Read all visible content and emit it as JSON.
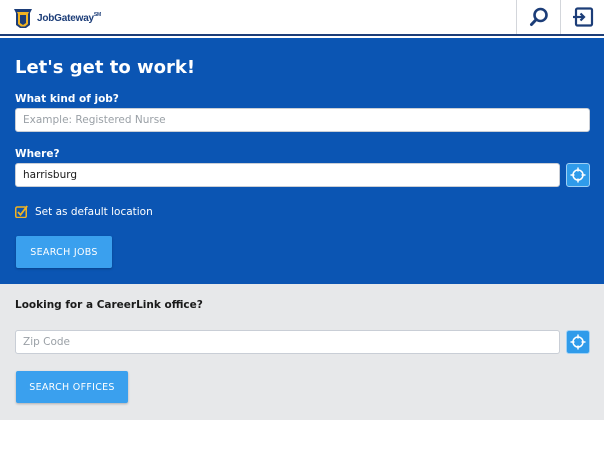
{
  "header": {
    "logo_text": "JobGateway",
    "logo_mark": "SM",
    "search_icon": "search-icon",
    "exit_icon": "exit-icon"
  },
  "hero": {
    "title": "Let's get to work!",
    "job_label": "What kind of job?",
    "job_placeholder": "Example: Registered Nurse",
    "job_value": "",
    "where_label": "Where?",
    "where_value": "harrisburg",
    "default_location_checked": true,
    "default_location_label": "Set as default location",
    "search_button": "SEARCH JOBS"
  },
  "offices": {
    "title": "Looking for a CareerLink office?",
    "zip_placeholder": "Zip Code",
    "zip_value": "",
    "search_button": "SEARCH OFFICES"
  },
  "colors": {
    "brand_navy": "#1c3d78",
    "hero_blue": "#0b55b3",
    "button_blue": "#3aa0ee",
    "checkbox_gold": "#f0b323",
    "offices_bg": "#e7e8ea"
  }
}
